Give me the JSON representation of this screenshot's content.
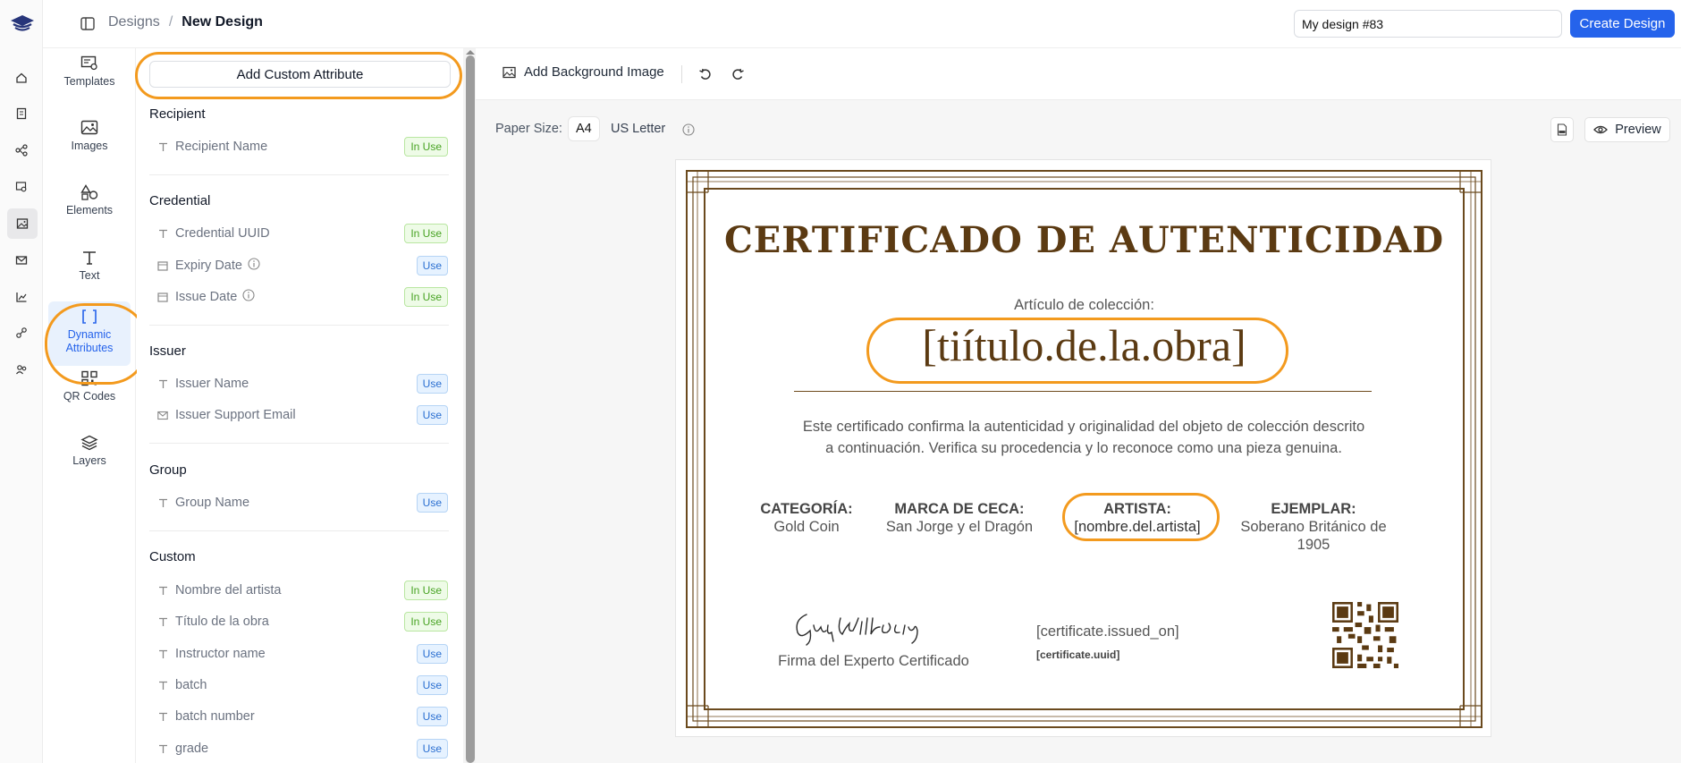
{
  "breadcrumb": {
    "parent": "Designs",
    "separator": "/",
    "current": "New Design"
  },
  "header": {
    "design_name": "My design #83",
    "create_label": "Create Design"
  },
  "tools": [
    {
      "label": "Templates",
      "icon": "templates-icon"
    },
    {
      "label": "Images",
      "icon": "image-icon"
    },
    {
      "label": "Elements",
      "icon": "shapes-icon"
    },
    {
      "label": "Text",
      "icon": "text-icon"
    },
    {
      "label": "Dynamic Attributes",
      "icon": "brackets-icon",
      "active": true
    },
    {
      "label": "QR Codes",
      "icon": "qr-icon"
    },
    {
      "label": "Layers",
      "icon": "layers-icon"
    }
  ],
  "panel": {
    "add_label": "Add Custom Attribute",
    "sections": [
      {
        "title": "Recipient",
        "items": [
          {
            "label": "Recipient Name",
            "status": "In Use"
          }
        ]
      },
      {
        "title": "Credential",
        "items": [
          {
            "label": "Credential UUID",
            "status": "In Use"
          },
          {
            "label": "Expiry Date",
            "status": "Use"
          },
          {
            "label": "Issue Date",
            "status": "In Use"
          }
        ]
      },
      {
        "title": "Issuer",
        "items": [
          {
            "label": "Issuer Name",
            "status": "Use"
          },
          {
            "label": "Issuer Support Email",
            "status": "Use"
          }
        ]
      },
      {
        "title": "Group",
        "items": [
          {
            "label": "Group Name",
            "status": "Use"
          }
        ]
      },
      {
        "title": "Custom",
        "items": [
          {
            "label": "Nombre del artista",
            "status": "In Use"
          },
          {
            "label": "Título de la obra",
            "status": "In Use"
          },
          {
            "label": "Instructor name",
            "status": "Use"
          },
          {
            "label": "batch",
            "status": "Use"
          },
          {
            "label": "batch number",
            "status": "Use"
          },
          {
            "label": "grade",
            "status": "Use"
          }
        ]
      }
    ]
  },
  "canvas": {
    "bg_label": "Add Background Image",
    "paper_label": "Paper Size:",
    "paper_options": [
      "A4",
      "US Letter"
    ],
    "selected_paper": "A4",
    "preview_label": "Preview"
  },
  "certificate": {
    "title": "CERTIFICADO DE AUTENTICIDAD",
    "subtitle": "Artículo de colección:",
    "work_title": "[tiítulo.de.la.obra]",
    "description": "Este certificado confirma la autenticidad y originalidad del objeto de colección descrito a continuación. Verifica su procedencia y lo reconoce como una pieza genuina.",
    "columns": [
      {
        "label": "CATEGORÍA:",
        "value": "Gold Coin"
      },
      {
        "label": "MARCA DE CECA:",
        "value": "San Jorge y el Dragón"
      },
      {
        "label": "ARTISTA:",
        "value": "[nombre.del.artista]"
      },
      {
        "label": "EJEMPLAR:",
        "value": "Soberano Británico de 1905"
      }
    ],
    "signature_caption": "Firma del Experto Certificado",
    "issued_on": "[certificate.issued_on]",
    "uuid": "[certificate.uuid]"
  },
  "colors": {
    "accent": "#2563eb",
    "highlight": "#f39a1e",
    "gold": "#5b3a12"
  }
}
